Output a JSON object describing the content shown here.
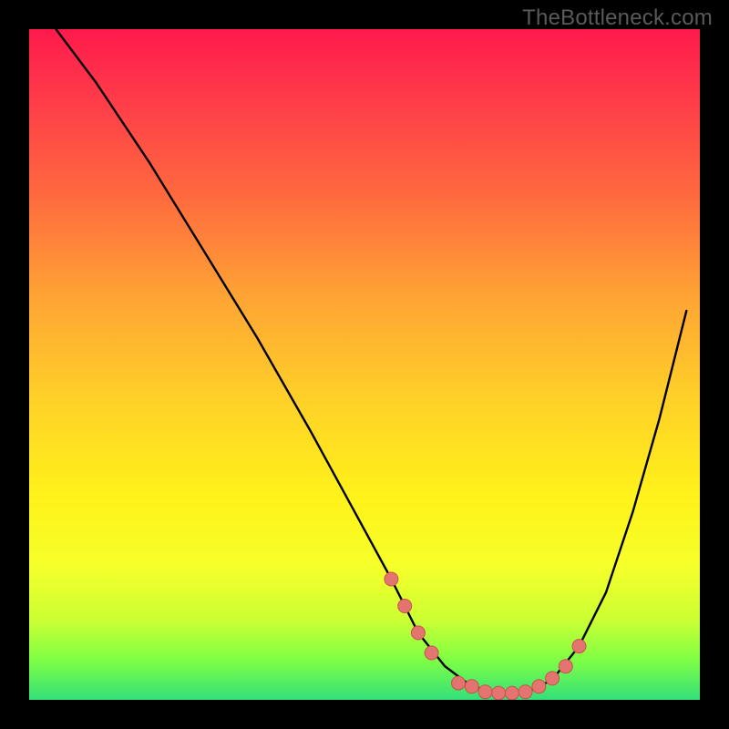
{
  "watermark": "TheBottleneck.com",
  "chart_data": {
    "type": "line",
    "title": "",
    "xlabel": "",
    "ylabel": "",
    "xlim": [
      0,
      100
    ],
    "ylim": [
      0,
      100
    ],
    "series": [
      {
        "name": "bottleneck-curve",
        "x": [
          4,
          10,
          18,
          26,
          34,
          42,
          48,
          54,
          58,
          62,
          66,
          70,
          74,
          78,
          82,
          86,
          90,
          94,
          98
        ],
        "y": [
          100,
          92,
          80,
          67,
          54,
          40,
          29,
          18,
          10,
          5,
          2,
          1,
          1,
          3,
          8,
          16,
          28,
          42,
          58
        ]
      }
    ],
    "markers": {
      "name": "highlight-points",
      "x": [
        54,
        56,
        58,
        60,
        64,
        66,
        68,
        70,
        72,
        74,
        76,
        78,
        80,
        82
      ],
      "y": [
        18,
        14,
        10,
        7,
        2.5,
        2,
        1.2,
        1,
        1,
        1.2,
        2,
        3.2,
        5,
        8
      ]
    },
    "colors": {
      "curve": "#000000",
      "marker_fill": "#e4746f",
      "marker_stroke": "#c9524d"
    }
  }
}
